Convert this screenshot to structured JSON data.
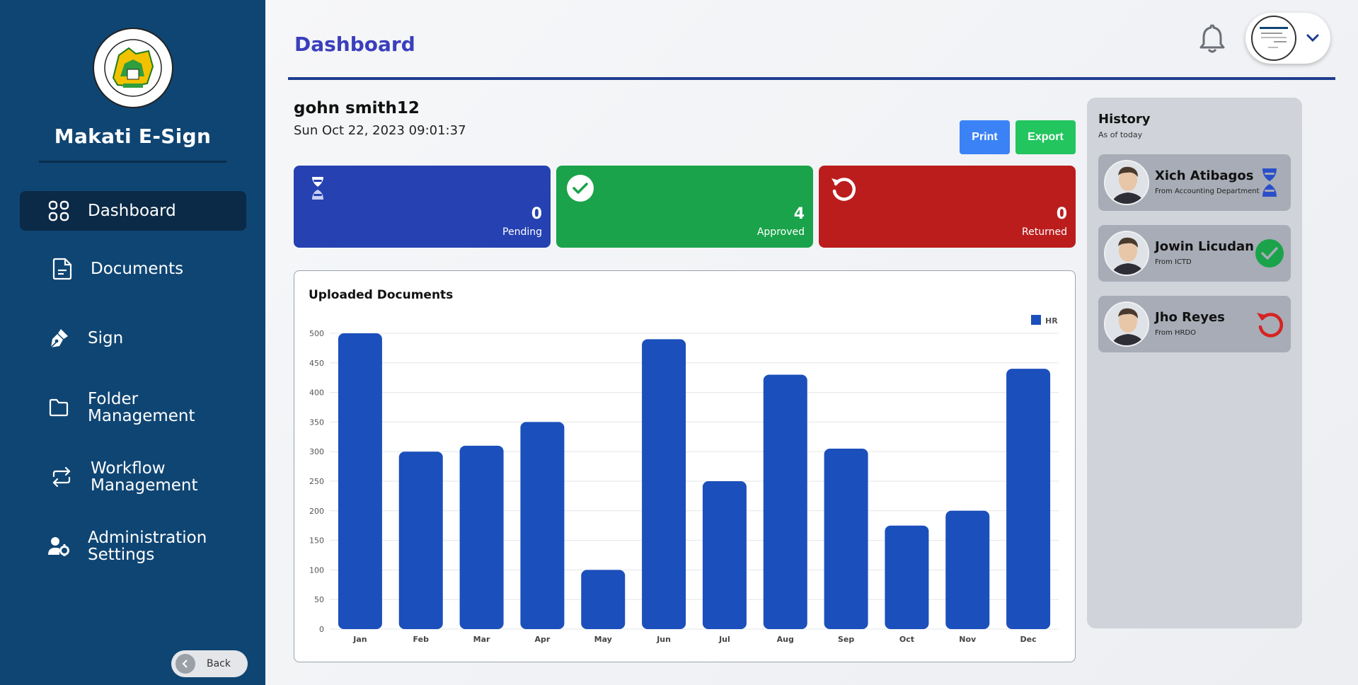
{
  "sidebar": {
    "brand": "Makati E-Sign",
    "logo_text": "LUNGSOD NG MAKATI · PILIPINAS · 1995",
    "items": [
      {
        "label": "Dashboard",
        "icon": "grid-icon"
      },
      {
        "label": "Documents",
        "icon": "document-icon"
      },
      {
        "label": "Sign",
        "icon": "pen-nib-icon"
      },
      {
        "label": "Folder Management",
        "icon": "folder-icon"
      },
      {
        "label": "Workflow Management",
        "icon": "repeat-arrows-icon"
      },
      {
        "label": "Administration Settings",
        "icon": "user-gear-icon"
      }
    ],
    "back_label": "Back"
  },
  "header": {
    "title": "Dashboard"
  },
  "user": {
    "name": "gohn smith12",
    "datetime": "Sun Oct 22, 2023 09:01:37"
  },
  "actions": {
    "print_label": "Print",
    "export_label": "Export"
  },
  "stats": [
    {
      "label": "Pending",
      "value": "0",
      "color": "#2541b2",
      "icon": "hourglass-icon"
    },
    {
      "label": "Approved",
      "value": "4",
      "color": "#1aa34a",
      "icon": "check-circle-icon"
    },
    {
      "label": "Returned",
      "value": "0",
      "color": "#bb1d1d",
      "icon": "undo-icon"
    }
  ],
  "chart": {
    "title": "Uploaded Documents"
  },
  "chart_data": {
    "type": "bar",
    "title": "Uploaded Documents",
    "categories": [
      "Jan",
      "Feb",
      "Mar",
      "Apr",
      "May",
      "Jun",
      "Jul",
      "Aug",
      "Sep",
      "Oct",
      "Nov",
      "Dec"
    ],
    "series": [
      {
        "name": "HR",
        "values": [
          500,
          300,
          310,
          350,
          100,
          490,
          250,
          430,
          305,
          175,
          200,
          440
        ],
        "color": "#1b4fbb"
      }
    ],
    "yticks": [
      0,
      50,
      100,
      150,
      200,
      250,
      300,
      350,
      400,
      450,
      500
    ],
    "ylim": [
      0,
      500
    ],
    "grid": true,
    "legend": "top-right"
  },
  "history": {
    "title": "History",
    "subtitle": "As of today",
    "items": [
      {
        "name": "Xich Atibagos",
        "dept": "From Accounting Department",
        "status": "pending",
        "status_icon": "hourglass-icon",
        "status_color": "#2b4fc9"
      },
      {
        "name": "Jowin Licudan",
        "dept": "From ICTD",
        "status": "approved",
        "status_icon": "check-circle-icon",
        "status_color": "#1aa34a"
      },
      {
        "name": "Jho Reyes",
        "dept": "From HRDO",
        "status": "returned",
        "status_icon": "undo-icon",
        "status_color": "#d62323"
      }
    ]
  }
}
